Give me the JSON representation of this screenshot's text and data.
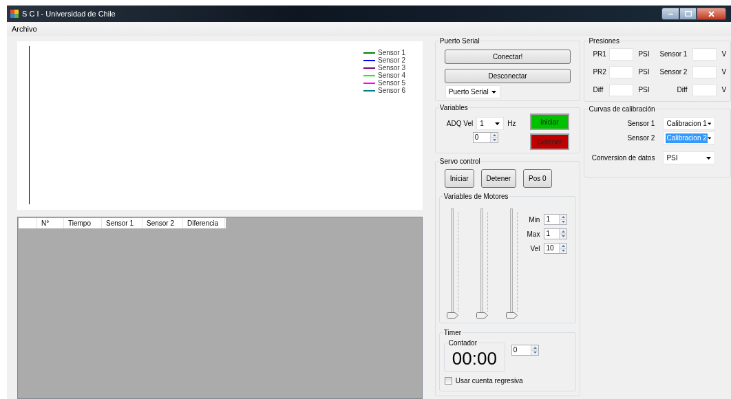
{
  "window": {
    "title": "S C I - Universidad de Chile"
  },
  "menu": [
    {
      "label": "Archivo"
    }
  ],
  "chart_legend": [
    {
      "name": "Sensor 1",
      "color": "#008000"
    },
    {
      "name": "Sensor 2",
      "color": "#0000ff"
    },
    {
      "name": "Sensor 3",
      "color": "#800080"
    },
    {
      "name": "Sensor 4",
      "color": "#00ff00"
    },
    {
      "name": "Sensor 5",
      "color": "#ff00ff"
    },
    {
      "name": "Sensor 6",
      "color": "#008080"
    }
  ],
  "table": {
    "columns": [
      "N°",
      "Tiempo",
      "Sensor 1",
      "Sensor 2",
      "Diferencia"
    ]
  },
  "puerto_serial": {
    "title": "Puerto Serial",
    "buttons": [
      "Conectar!",
      "Desconectar"
    ],
    "port": "Puerto Serial"
  },
  "variables": {
    "title": "Variables",
    "adq_label": "ADQ Vel",
    "adq_value": "1",
    "adq_unit": "Hz",
    "spinner": "0",
    "buttons": [
      {
        "label": "Iniciar",
        "kind": "start"
      },
      {
        "label": "Detener",
        "kind": "stop"
      }
    ]
  },
  "servo_control": {
    "title": "Servo control",
    "buttons": [
      "Iniciar",
      "Detener",
      "Pos 0"
    ],
    "motores": {
      "title": "Variables de Motores",
      "sliders": [
        {
          "level": 0
        },
        {
          "level": 0
        },
        {
          "level": 0
        }
      ],
      "fields": [
        {
          "label": "Min",
          "value": "1"
        },
        {
          "label": "Max",
          "value": "1"
        },
        {
          "label": "Vel",
          "value": "10"
        }
      ]
    },
    "timer": {
      "title": "Timer",
      "counter_title": "Contador",
      "time": "00:00",
      "spinner": "0",
      "checkbox": {
        "label": "Usar cuenta regresiva",
        "checked": false
      }
    }
  },
  "presiones": {
    "title": "Presiones",
    "rows": [
      {
        "label": "PR1",
        "unit": "PSI",
        "label_2": "Sensor 1",
        "unit_2": "V"
      },
      {
        "label": "PR2",
        "unit": "PSI",
        "label_2": "Sensor 2",
        "unit_2": "V"
      },
      {
        "label": "Diff",
        "unit": "PSI",
        "label_2": "Diff",
        "unit_2": "V"
      }
    ]
  },
  "curvas": {
    "title": "Curvas de calibración",
    "rows": [
      {
        "label": "Sensor 1",
        "value": "Calibracion 1",
        "selected": false
      },
      {
        "label": "Sensor 2",
        "value": "Calibracion 2",
        "selected": true
      }
    ],
    "conversion": {
      "label": "Conversion de datos",
      "value": "PSI"
    }
  }
}
